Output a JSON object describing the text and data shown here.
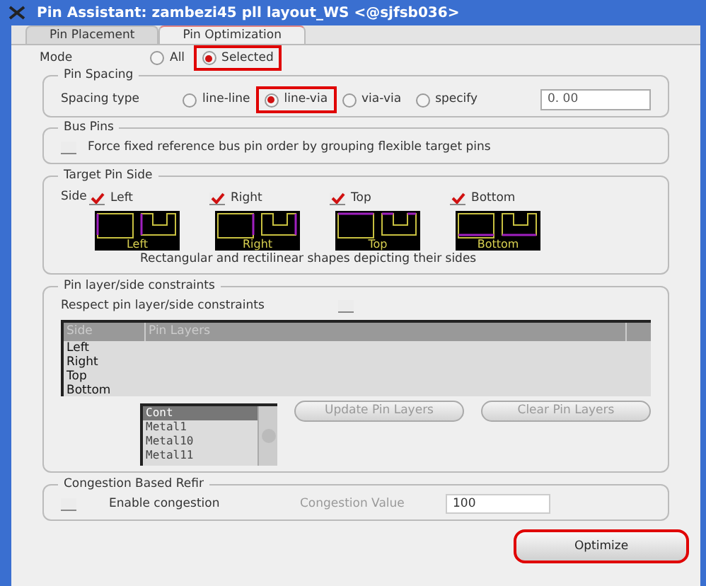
{
  "window": {
    "title": "Pin Assistant: zambezi45 pll layout_WS <@sjfsb036>"
  },
  "tabs": [
    {
      "label": "Pin Placement",
      "selected": false
    },
    {
      "label": "Pin Optimization",
      "selected": true
    }
  ],
  "mode": {
    "label": "Mode",
    "options": [
      {
        "label": "All",
        "selected": false,
        "highlighted": false
      },
      {
        "label": "Selected",
        "selected": true,
        "highlighted": true
      }
    ]
  },
  "pin_spacing": {
    "title": "Pin Spacing",
    "label": "Spacing type",
    "options": [
      {
        "label": "line-line",
        "selected": false,
        "highlighted": false
      },
      {
        "label": "line-via",
        "selected": true,
        "highlighted": true
      },
      {
        "label": "via-via",
        "selected": false,
        "highlighted": false
      },
      {
        "label": "specify",
        "selected": false,
        "highlighted": false
      }
    ],
    "value": "0. 00"
  },
  "bus_pins": {
    "title": "Bus Pins",
    "checkbox": {
      "label": "Force fixed reference bus pin order by grouping flexible target pins",
      "checked": false
    }
  },
  "target_pin_side": {
    "title": "Target Pin Side",
    "label": "Side",
    "sides": [
      {
        "label": "Left",
        "checked": true,
        "diagram_label": "Left",
        "kind": "left"
      },
      {
        "label": "Right",
        "checked": true,
        "diagram_label": "Right",
        "kind": "right"
      },
      {
        "label": "Top",
        "checked": true,
        "diagram_label": "Top",
        "kind": "top"
      },
      {
        "label": "Bottom",
        "checked": true,
        "diagram_label": "Bottom",
        "kind": "bottom"
      }
    ],
    "caption": "Rectangular and rectilinear shapes depicting their sides"
  },
  "pin_constraints": {
    "title": "Pin layer/side constraints",
    "checkbox": {
      "label": "Respect pin layer/side constraints",
      "checked": false
    },
    "table": {
      "columns": [
        "Side",
        "Pin Layers"
      ],
      "rows": [
        "Left",
        "Right",
        "Top",
        "Bottom"
      ]
    },
    "layers": [
      {
        "label": "Cont",
        "selected": true
      },
      {
        "label": "Metal1",
        "selected": false
      },
      {
        "label": "Metal10",
        "selected": false
      },
      {
        "label": "Metal11",
        "selected": false
      }
    ],
    "buttons": [
      {
        "label": "Update Pin Layers",
        "disabled": true
      },
      {
        "label": "Clear Pin Layers",
        "disabled": true
      }
    ]
  },
  "congestion": {
    "title": "Congestion Based Refir",
    "checkbox": {
      "label": "Enable congestion",
      "checked": false
    },
    "value_label": "Congestion Value",
    "value": "100"
  },
  "optimize": {
    "label": "Optimize",
    "highlighted": true
  }
}
